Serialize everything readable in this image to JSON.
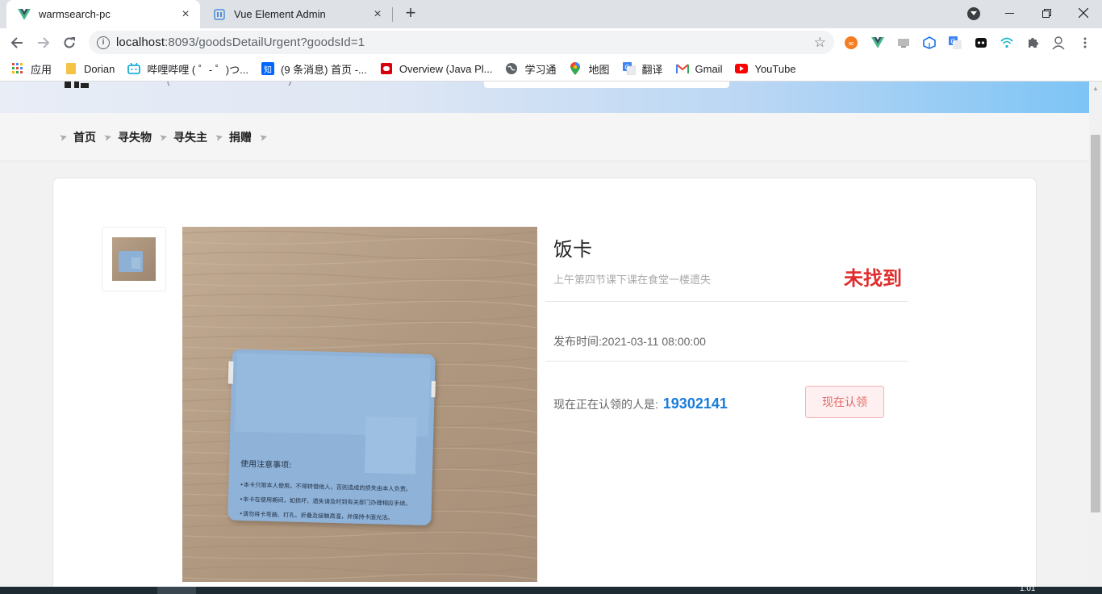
{
  "browser": {
    "tabs": [
      {
        "title": "warmsearch-pc",
        "active": true,
        "icon": "vue-icon"
      },
      {
        "title": "Vue Element Admin",
        "active": false,
        "icon": "element-admin-icon"
      }
    ],
    "url_host": "localhost",
    "url_rest": ":8093/goodsDetailUrgent?goodsId=1",
    "bookmarks": [
      {
        "label": "应用",
        "icon": "apps-grid-icon"
      },
      {
        "label": "Dorian",
        "icon": "folder-icon"
      },
      {
        "label": "哔哩哔哩 ( ゜- ゜)つ...",
        "icon": "bilibili-icon"
      },
      {
        "label": "(9 条消息) 首页 -...",
        "icon": "zhihu-icon"
      },
      {
        "label": "Overview (Java Pl...",
        "icon": "java-icon"
      },
      {
        "label": "学习通",
        "icon": "globe-icon"
      },
      {
        "label": "地图",
        "icon": "maps-icon"
      },
      {
        "label": "翻译",
        "icon": "translate-icon"
      },
      {
        "label": "Gmail",
        "icon": "gmail-icon"
      },
      {
        "label": "YouTube",
        "icon": "youtube-icon"
      }
    ],
    "taskbar_clock": "1:01"
  },
  "nav": {
    "items": [
      "首页",
      "寻失物",
      "寻失主",
      "捐赠"
    ]
  },
  "goods": {
    "name": "饭卡",
    "description": "上午第四节课下课在食堂一楼遗失",
    "status": "未找到",
    "publish_time": "发布时间:2021-03-11 08:00:00",
    "claim_label": "现在正在认领的人是:",
    "claim_user_id": "19302141",
    "claim_button": "现在认领"
  },
  "card_photo": {
    "notice_title": "使用注意事项:",
    "notice_lines": [
      "•本卡只限本人使用，不得转借他人，否则造成的损失由本人负责。",
      "•本卡在使用期间，如损坏、遗失请及时到有关部门办理相应手续。",
      "•请勿将卡弯曲、打孔、折叠及接触高温，并保持卡面光洁。"
    ]
  },
  "colors": {
    "status_red": "#e02d2d",
    "claim_blue": "#1a7cd9",
    "button_border": "#f4b4b4"
  }
}
